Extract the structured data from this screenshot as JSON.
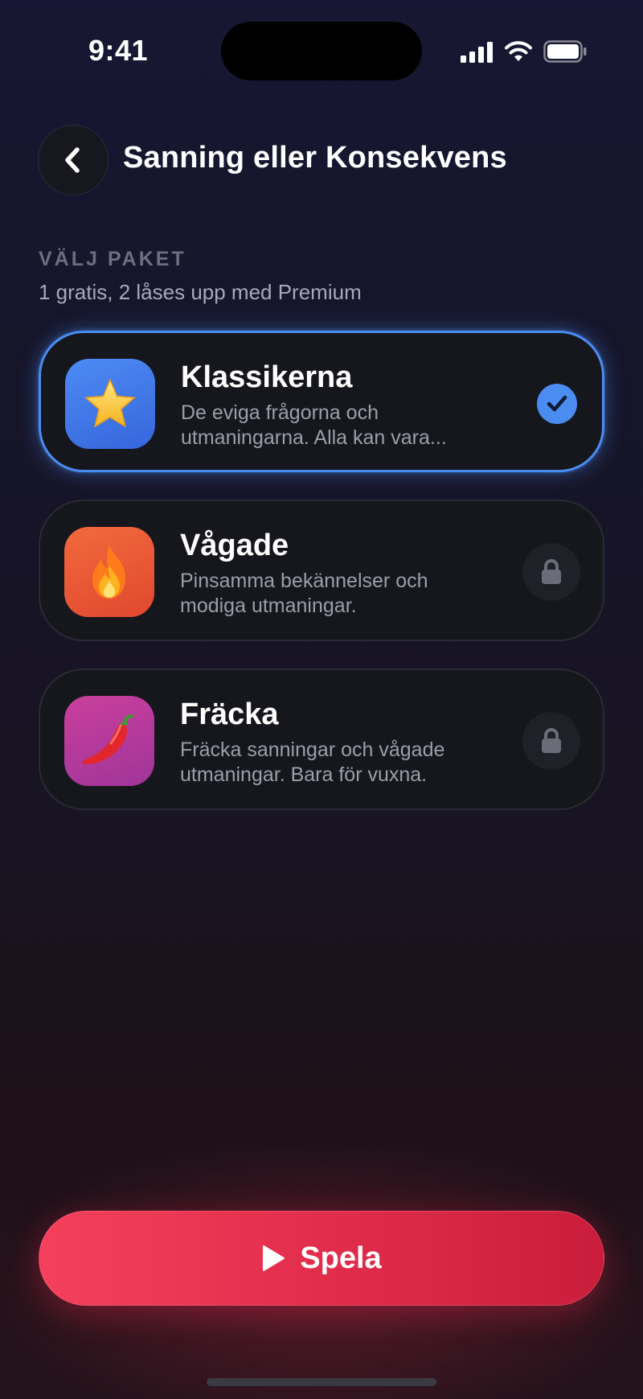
{
  "status_bar": {
    "time": "9:41",
    "icons": [
      "signal-icon",
      "wifi-icon",
      "battery-icon"
    ]
  },
  "header": {
    "back_icon": "chevron-left-icon",
    "title": "Sanning eller Konsekvens"
  },
  "section": {
    "label": "VÄLJ PAKET",
    "subtitle": "1 gratis, 2 låses upp med Premium"
  },
  "packs": [
    {
      "name": "Klassikerna",
      "description": "De eviga frågorna och utmaningarna. Alla kan vara...",
      "icon": "star-icon",
      "emoji": "⭐",
      "color": "#4d8bf5",
      "status": "selected",
      "status_icon": "checkmark-icon"
    },
    {
      "name": "Vågade",
      "description": "Pinsamma bekännelser och modiga utmaningar.",
      "icon": "fire-icon",
      "emoji": "🔥",
      "color": "#f26a3d",
      "status": "locked",
      "status_icon": "lock-icon"
    },
    {
      "name": "Fräcka",
      "description": "Fräcka sanningar och vågade utmaningar. Bara för vuxna.",
      "icon": "chili-pepper-icon",
      "emoji": "🌶️",
      "color": "#c93f9c",
      "status": "locked",
      "status_icon": "lock-icon"
    }
  ],
  "play_button": {
    "label": "Spela",
    "icon": "play-icon",
    "color": "#e8304f"
  },
  "colors": {
    "accent_selected": "#4a8cf0",
    "background_top": "#171733",
    "background_bottom": "#24121a"
  }
}
